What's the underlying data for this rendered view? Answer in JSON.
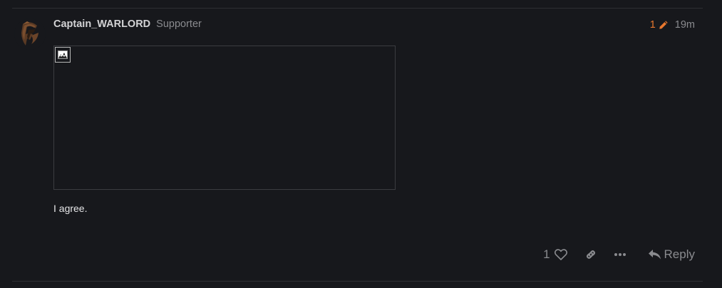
{
  "post": {
    "username": "Captain_WARLORD",
    "user_title": "Supporter",
    "edit_count": "1",
    "age": "19m",
    "body_text": "I agree.",
    "image": {
      "state": "broken-image-icon"
    },
    "actions": {
      "like_count": "1",
      "reply_label": "Reply"
    }
  },
  "colors": {
    "background": "#17181c",
    "accent_edit": "#e8772e",
    "muted_text": "#8a8b8f",
    "username": "#d3d3d5",
    "divider": "#2e2f33"
  },
  "icons": {
    "edit": "pencil-icon",
    "like": "heart-icon",
    "share": "link-icon",
    "more": "ellipsis-icon",
    "reply": "reply-arrow-icon"
  }
}
